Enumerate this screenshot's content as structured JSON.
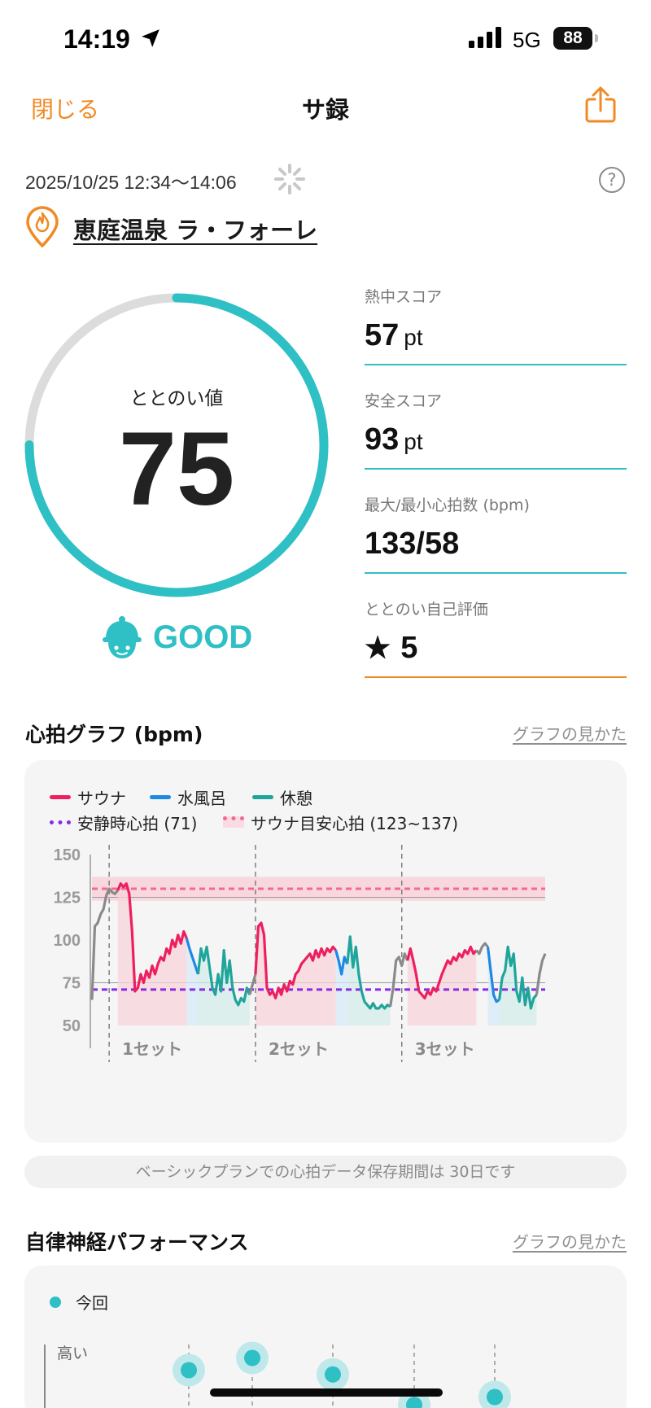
{
  "status_bar": {
    "time": "14:19",
    "network": "5G",
    "battery": "88"
  },
  "nav": {
    "close_label": "閉じる",
    "title": "サ録"
  },
  "session": {
    "datetime": "2025/10/25 12:34〜14:06",
    "place": "恵庭温泉 ラ・フォーレ"
  },
  "gauge": {
    "label": "ととのい値",
    "value": "75",
    "fill_fraction": 0.75,
    "rating": "GOOD"
  },
  "stats": [
    {
      "label": "熱中スコア",
      "value": "57",
      "unit": "pt"
    },
    {
      "label": "安全スコア",
      "value": "93",
      "unit": "pt"
    },
    {
      "label": "最大/最小心拍数 (bpm)",
      "value": "133/58",
      "unit": ""
    },
    {
      "label": "ととのい自己評価",
      "value": "5",
      "unit": ""
    }
  ],
  "heart_section": {
    "title": "心拍グラフ (bpm)",
    "link": "グラフの見かた"
  },
  "legend": {
    "sauna": "サウナ",
    "cold_bath": "水風呂",
    "rest": "休憩",
    "resting_hr": "安静時心拍 (71)",
    "target_hr": "サウナ目安心拍 (123~137)"
  },
  "chart_data": {
    "type": "line",
    "xlabel": "",
    "ylabel": "",
    "ylim": [
      50,
      150
    ],
    "yticks": [
      "150",
      "125",
      "100",
      "75",
      "50"
    ],
    "sets": [
      "1セット",
      "2セット",
      "3セット"
    ],
    "resting_hr": 71,
    "target_range": [
      123,
      137
    ],
    "target_line": 130,
    "colors": {
      "sauna": "#ee1f5f",
      "cold_bath": "#1e88e5",
      "rest": "#1fa59c",
      "other": "#8a8a8a",
      "resting": "#8a2be2",
      "target": "#f06b91"
    },
    "series": [
      {
        "name": "",
        "kind": "other",
        "values": [
          [
            0,
            65
          ],
          [
            1,
            108
          ],
          [
            2,
            110
          ],
          [
            3,
            115
          ],
          [
            4,
            118
          ],
          [
            5,
            126
          ],
          [
            6,
            130
          ],
          [
            7,
            128
          ],
          [
            8,
            127
          ],
          [
            9,
            129
          ]
        ]
      },
      {
        "name": "サウナ",
        "kind": "sauna",
        "values": [
          [
            9,
            129
          ],
          [
            10,
            133
          ],
          [
            11,
            131
          ],
          [
            12,
            133
          ],
          [
            13,
            127
          ],
          [
            14,
            105
          ],
          [
            15,
            70
          ],
          [
            16,
            72
          ],
          [
            17,
            80
          ],
          [
            18,
            75
          ],
          [
            19,
            82
          ],
          [
            20,
            78
          ],
          [
            21,
            85
          ],
          [
            22,
            80
          ],
          [
            23,
            86
          ],
          [
            24,
            90
          ],
          [
            25,
            88
          ],
          [
            26,
            95
          ],
          [
            27,
            92
          ],
          [
            28,
            100
          ],
          [
            29,
            96
          ],
          [
            30,
            103
          ],
          [
            31,
            98
          ],
          [
            32,
            105
          ],
          [
            33,
            101
          ]
        ]
      },
      {
        "name": "水風呂",
        "kind": "cold_bath",
        "values": [
          [
            33,
            101
          ],
          [
            34,
            95
          ],
          [
            35,
            90
          ],
          [
            36,
            85
          ],
          [
            37,
            80
          ]
        ]
      },
      {
        "name": "休憩",
        "kind": "rest",
        "values": [
          [
            37,
            80
          ],
          [
            38,
            95
          ],
          [
            39,
            88
          ],
          [
            40,
            96
          ],
          [
            41,
            84
          ],
          [
            42,
            72
          ],
          [
            43,
            68
          ],
          [
            44,
            80
          ],
          [
            45,
            70
          ],
          [
            46,
            94
          ],
          [
            47,
            75
          ],
          [
            48,
            88
          ],
          [
            49,
            72
          ],
          [
            50,
            65
          ],
          [
            51,
            62
          ],
          [
            52,
            66
          ],
          [
            53,
            64
          ],
          [
            54,
            72
          ],
          [
            55,
            68
          ]
        ]
      },
      {
        "name": "",
        "kind": "other",
        "values": [
          [
            55,
            68
          ],
          [
            56,
            74
          ],
          [
            57,
            80
          ]
        ]
      },
      {
        "name": "サウナ",
        "kind": "sauna",
        "values": [
          [
            57,
            80
          ],
          [
            58,
            108
          ],
          [
            59,
            110
          ],
          [
            60,
            103
          ],
          [
            61,
            72
          ],
          [
            62,
            68
          ],
          [
            63,
            70
          ],
          [
            64,
            66
          ],
          [
            65,
            72
          ],
          [
            66,
            68
          ],
          [
            67,
            74
          ],
          [
            68,
            70
          ],
          [
            69,
            76
          ],
          [
            70,
            74
          ],
          [
            71,
            80
          ],
          [
            72,
            82
          ],
          [
            73,
            86
          ],
          [
            74,
            88
          ],
          [
            75,
            90
          ],
          [
            76,
            92
          ],
          [
            77,
            88
          ],
          [
            78,
            94
          ],
          [
            79,
            90
          ],
          [
            80,
            95
          ],
          [
            81,
            91
          ],
          [
            82,
            95
          ],
          [
            83,
            93
          ],
          [
            84,
            96
          ],
          [
            85,
            94
          ]
        ]
      },
      {
        "name": "水風呂",
        "kind": "cold_bath",
        "values": [
          [
            85,
            94
          ],
          [
            86,
            88
          ],
          [
            87,
            80
          ],
          [
            88,
            90
          ],
          [
            89,
            86
          ]
        ]
      },
      {
        "name": "休憩",
        "kind": "rest",
        "values": [
          [
            89,
            86
          ],
          [
            90,
            102
          ],
          [
            91,
            84
          ],
          [
            92,
            96
          ],
          [
            93,
            80
          ],
          [
            94,
            70
          ],
          [
            95,
            64
          ],
          [
            96,
            62
          ],
          [
            97,
            60
          ],
          [
            98,
            63
          ],
          [
            99,
            60
          ],
          [
            100,
            60
          ],
          [
            101,
            62
          ],
          [
            102,
            60
          ],
          [
            103,
            62
          ],
          [
            104,
            61
          ]
        ]
      },
      {
        "name": "",
        "kind": "other",
        "values": [
          [
            104,
            61
          ],
          [
            105,
            72
          ],
          [
            106,
            88
          ],
          [
            107,
            90
          ],
          [
            108,
            85
          ],
          [
            109,
            92
          ],
          [
            110,
            88
          ]
        ]
      },
      {
        "name": "サウナ",
        "kind": "sauna",
        "values": [
          [
            110,
            88
          ],
          [
            111,
            95
          ],
          [
            112,
            88
          ],
          [
            113,
            80
          ],
          [
            114,
            70
          ],
          [
            115,
            68
          ],
          [
            116,
            66
          ],
          [
            117,
            70
          ],
          [
            118,
            68
          ],
          [
            119,
            72
          ],
          [
            120,
            70
          ],
          [
            121,
            75
          ],
          [
            122,
            80
          ],
          [
            123,
            84
          ],
          [
            124,
            88
          ],
          [
            125,
            86
          ],
          [
            126,
            90
          ],
          [
            127,
            88
          ],
          [
            128,
            92
          ],
          [
            129,
            90
          ],
          [
            130,
            94
          ],
          [
            131,
            92
          ],
          [
            132,
            96
          ],
          [
            133,
            92
          ],
          [
            134,
            94
          ]
        ]
      },
      {
        "name": "",
        "kind": "other",
        "values": [
          [
            134,
            94
          ],
          [
            135,
            92
          ],
          [
            136,
            96
          ],
          [
            137,
            98
          ],
          [
            138,
            96
          ]
        ]
      },
      {
        "name": "水風呂",
        "kind": "cold_bath",
        "values": [
          [
            138,
            96
          ],
          [
            139,
            82
          ],
          [
            140,
            68
          ],
          [
            141,
            64
          ],
          [
            142,
            65
          ]
        ]
      },
      {
        "name": "休憩",
        "kind": "rest",
        "values": [
          [
            142,
            65
          ],
          [
            143,
            78
          ],
          [
            144,
            82
          ],
          [
            145,
            96
          ],
          [
            146,
            85
          ],
          [
            147,
            92
          ],
          [
            148,
            70
          ],
          [
            149,
            64
          ],
          [
            150,
            78
          ],
          [
            151,
            62
          ],
          [
            152,
            72
          ],
          [
            153,
            60
          ],
          [
            154,
            66
          ],
          [
            155,
            68
          ]
        ]
      },
      {
        "name": "",
        "kind": "other",
        "values": [
          [
            155,
            68
          ],
          [
            156,
            80
          ],
          [
            157,
            88
          ],
          [
            158,
            92
          ]
        ]
      }
    ],
    "set_markers_x": [
      6,
      57,
      108
    ]
  },
  "notice": "ベーシックプランでの心拍データ保存期間は 30日です",
  "ans_section": {
    "title": "自律神経パフォーマンス",
    "link": "グラフの見かた",
    "legend": "今回",
    "y_top_label": "高い"
  },
  "ans_chart": {
    "points": [
      0.62,
      0.82,
      0.55,
      0.05,
      0.18
    ]
  }
}
